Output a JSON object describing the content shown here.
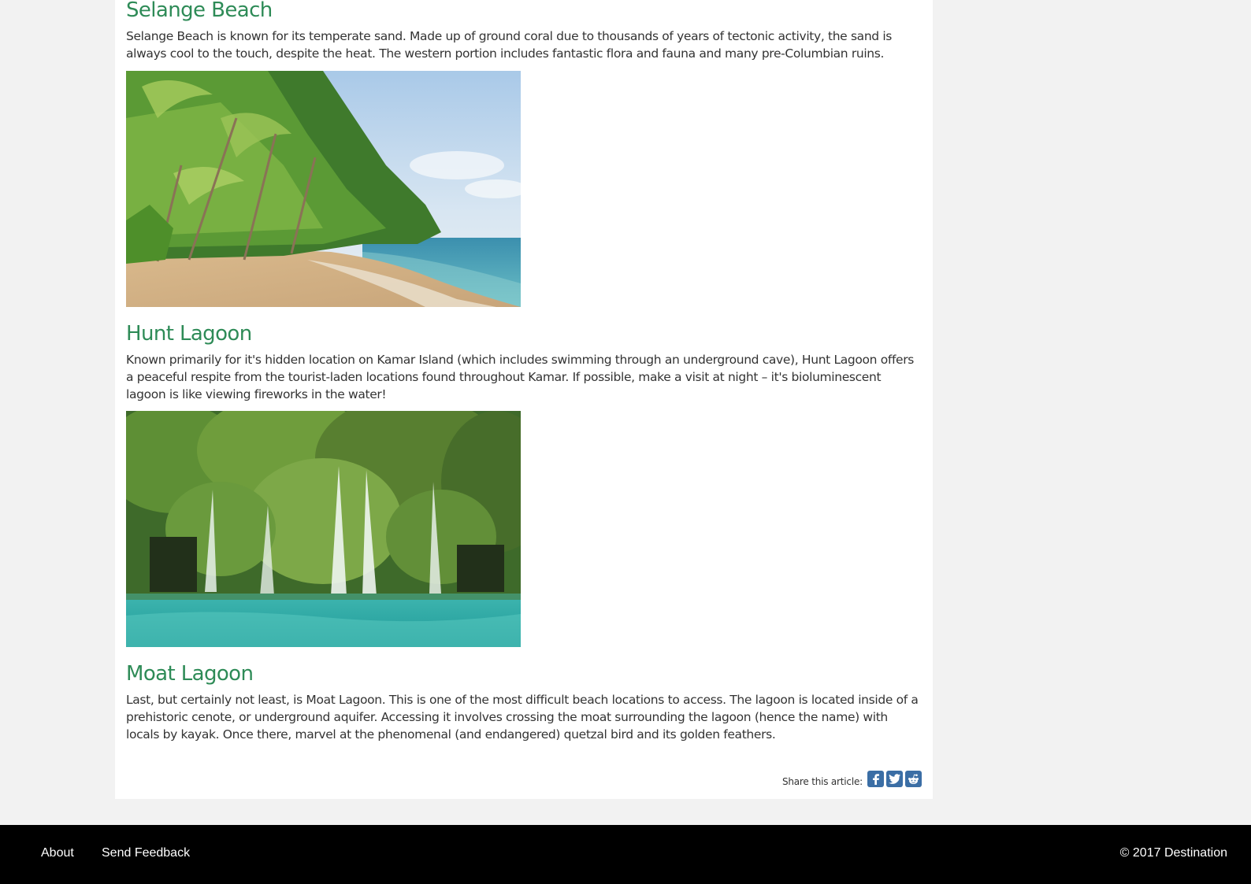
{
  "article": {
    "sections": [
      {
        "title": "Selange Beach",
        "body": "Selange Beach is known for its temperate sand. Made up of ground coral due to thousands of years of tectonic activity, the sand is always cool to the touch, despite the heat. The western portion includes fantastic flora and fauna and many pre-Columbian ruins."
      },
      {
        "title": "Hunt Lagoon",
        "body": "Known primarily for it's hidden location on Kamar Island (which includes swimming through an underground cave), Hunt Lagoon offers a peaceful respite from the tourist-laden locations found throughout Kamar. If possible, make a visit at night – it's bioluminescent lagoon is like viewing fireworks in the water!"
      },
      {
        "title": "Moat Lagoon",
        "body": "Last, but certainly not least, is Moat Lagoon. This is one of the most difficult beach locations to access. The lagoon is located inside of a prehistoric cenote, or underground aquifer. Accessing it involves crossing the moat surrounding the lagoon (hence the name) with locals by kayak. Once there, marvel at the phenomenal (and endangered) quetzal bird and its golden feathers."
      }
    ],
    "share": {
      "label": "Share this article:",
      "icons": [
        "facebook-icon",
        "twitter-icon",
        "reddit-icon"
      ],
      "button_color": "#3b6ea5"
    },
    "heading_color": "#2e8b57"
  },
  "footer": {
    "links": [
      "About",
      "Send Feedback"
    ],
    "copyright": "© 2017 Destination"
  }
}
